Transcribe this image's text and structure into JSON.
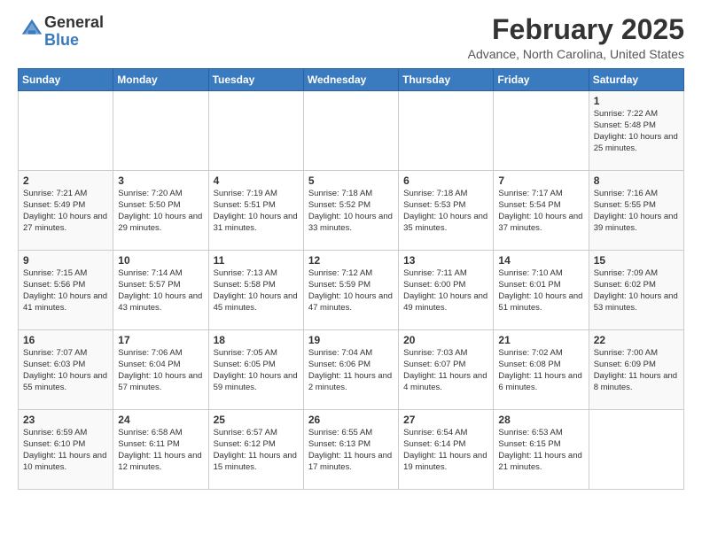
{
  "header": {
    "logo_general": "General",
    "logo_blue": "Blue",
    "month": "February 2025",
    "location": "Advance, North Carolina, United States"
  },
  "weekdays": [
    "Sunday",
    "Monday",
    "Tuesday",
    "Wednesday",
    "Thursday",
    "Friday",
    "Saturday"
  ],
  "weeks": [
    [
      {
        "day": "",
        "info": ""
      },
      {
        "day": "",
        "info": ""
      },
      {
        "day": "",
        "info": ""
      },
      {
        "day": "",
        "info": ""
      },
      {
        "day": "",
        "info": ""
      },
      {
        "day": "",
        "info": ""
      },
      {
        "day": "1",
        "info": "Sunrise: 7:22 AM\nSunset: 5:48 PM\nDaylight: 10 hours and 25 minutes."
      }
    ],
    [
      {
        "day": "2",
        "info": "Sunrise: 7:21 AM\nSunset: 5:49 PM\nDaylight: 10 hours and 27 minutes."
      },
      {
        "day": "3",
        "info": "Sunrise: 7:20 AM\nSunset: 5:50 PM\nDaylight: 10 hours and 29 minutes."
      },
      {
        "day": "4",
        "info": "Sunrise: 7:19 AM\nSunset: 5:51 PM\nDaylight: 10 hours and 31 minutes."
      },
      {
        "day": "5",
        "info": "Sunrise: 7:18 AM\nSunset: 5:52 PM\nDaylight: 10 hours and 33 minutes."
      },
      {
        "day": "6",
        "info": "Sunrise: 7:18 AM\nSunset: 5:53 PM\nDaylight: 10 hours and 35 minutes."
      },
      {
        "day": "7",
        "info": "Sunrise: 7:17 AM\nSunset: 5:54 PM\nDaylight: 10 hours and 37 minutes."
      },
      {
        "day": "8",
        "info": "Sunrise: 7:16 AM\nSunset: 5:55 PM\nDaylight: 10 hours and 39 minutes."
      }
    ],
    [
      {
        "day": "9",
        "info": "Sunrise: 7:15 AM\nSunset: 5:56 PM\nDaylight: 10 hours and 41 minutes."
      },
      {
        "day": "10",
        "info": "Sunrise: 7:14 AM\nSunset: 5:57 PM\nDaylight: 10 hours and 43 minutes."
      },
      {
        "day": "11",
        "info": "Sunrise: 7:13 AM\nSunset: 5:58 PM\nDaylight: 10 hours and 45 minutes."
      },
      {
        "day": "12",
        "info": "Sunrise: 7:12 AM\nSunset: 5:59 PM\nDaylight: 10 hours and 47 minutes."
      },
      {
        "day": "13",
        "info": "Sunrise: 7:11 AM\nSunset: 6:00 PM\nDaylight: 10 hours and 49 minutes."
      },
      {
        "day": "14",
        "info": "Sunrise: 7:10 AM\nSunset: 6:01 PM\nDaylight: 10 hours and 51 minutes."
      },
      {
        "day": "15",
        "info": "Sunrise: 7:09 AM\nSunset: 6:02 PM\nDaylight: 10 hours and 53 minutes."
      }
    ],
    [
      {
        "day": "16",
        "info": "Sunrise: 7:07 AM\nSunset: 6:03 PM\nDaylight: 10 hours and 55 minutes."
      },
      {
        "day": "17",
        "info": "Sunrise: 7:06 AM\nSunset: 6:04 PM\nDaylight: 10 hours and 57 minutes."
      },
      {
        "day": "18",
        "info": "Sunrise: 7:05 AM\nSunset: 6:05 PM\nDaylight: 10 hours and 59 minutes."
      },
      {
        "day": "19",
        "info": "Sunrise: 7:04 AM\nSunset: 6:06 PM\nDaylight: 11 hours and 2 minutes."
      },
      {
        "day": "20",
        "info": "Sunrise: 7:03 AM\nSunset: 6:07 PM\nDaylight: 11 hours and 4 minutes."
      },
      {
        "day": "21",
        "info": "Sunrise: 7:02 AM\nSunset: 6:08 PM\nDaylight: 11 hours and 6 minutes."
      },
      {
        "day": "22",
        "info": "Sunrise: 7:00 AM\nSunset: 6:09 PM\nDaylight: 11 hours and 8 minutes."
      }
    ],
    [
      {
        "day": "23",
        "info": "Sunrise: 6:59 AM\nSunset: 6:10 PM\nDaylight: 11 hours and 10 minutes."
      },
      {
        "day": "24",
        "info": "Sunrise: 6:58 AM\nSunset: 6:11 PM\nDaylight: 11 hours and 12 minutes."
      },
      {
        "day": "25",
        "info": "Sunrise: 6:57 AM\nSunset: 6:12 PM\nDaylight: 11 hours and 15 minutes."
      },
      {
        "day": "26",
        "info": "Sunrise: 6:55 AM\nSunset: 6:13 PM\nDaylight: 11 hours and 17 minutes."
      },
      {
        "day": "27",
        "info": "Sunrise: 6:54 AM\nSunset: 6:14 PM\nDaylight: 11 hours and 19 minutes."
      },
      {
        "day": "28",
        "info": "Sunrise: 6:53 AM\nSunset: 6:15 PM\nDaylight: 11 hours and 21 minutes."
      },
      {
        "day": "",
        "info": ""
      }
    ]
  ]
}
